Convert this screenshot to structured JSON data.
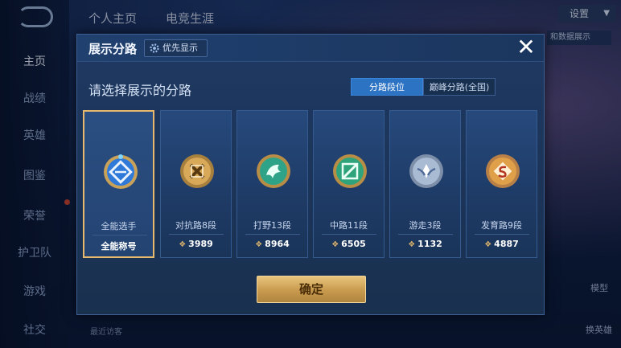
{
  "background": {
    "nav_items": [
      "主页",
      "战绩",
      "英雄",
      "图鉴",
      "荣誉",
      "护卫队",
      "游戏",
      "社交"
    ],
    "top_tabs": [
      "个人主页",
      "电竞生涯"
    ],
    "settings_label": "设置",
    "side_button": "和数据展示",
    "model_label": "模型",
    "change_hero_label": "换英雄",
    "recent_visitors": "最近访客"
  },
  "modal": {
    "title": "展示分路",
    "pref_chip": "优先显示",
    "close_icon": "✕",
    "subtitle": "请选择展示的分路",
    "toggle": [
      "分路段位",
      "巅峰分路(全国)"
    ],
    "confirm_label": "确定"
  },
  "cards": [
    {
      "name": "全能选手",
      "value": "全能称号",
      "wing": "",
      "badge": "all-round",
      "color": "#2f79d8"
    },
    {
      "name": "对抗路8段",
      "value": "3989",
      "wing": "❖",
      "badge": "clash-lane",
      "color": "#c89444"
    },
    {
      "name": "打野13段",
      "value": "8964",
      "wing": "❖",
      "badge": "jungle",
      "color": "#2fa387"
    },
    {
      "name": "中路11段",
      "value": "6505",
      "wing": "❖",
      "badge": "mid-lane",
      "color": "#2fa37c"
    },
    {
      "name": "游走3段",
      "value": "1132",
      "wing": "❖",
      "badge": "roam",
      "color": "#8fa2bd"
    },
    {
      "name": "发育路9段",
      "value": "4887",
      "wing": "❖",
      "badge": "farm-lane",
      "color": "#d18436"
    }
  ],
  "colors": {
    "accent_gold": "#e8b96c",
    "toggle_active": "#2d73c4"
  }
}
